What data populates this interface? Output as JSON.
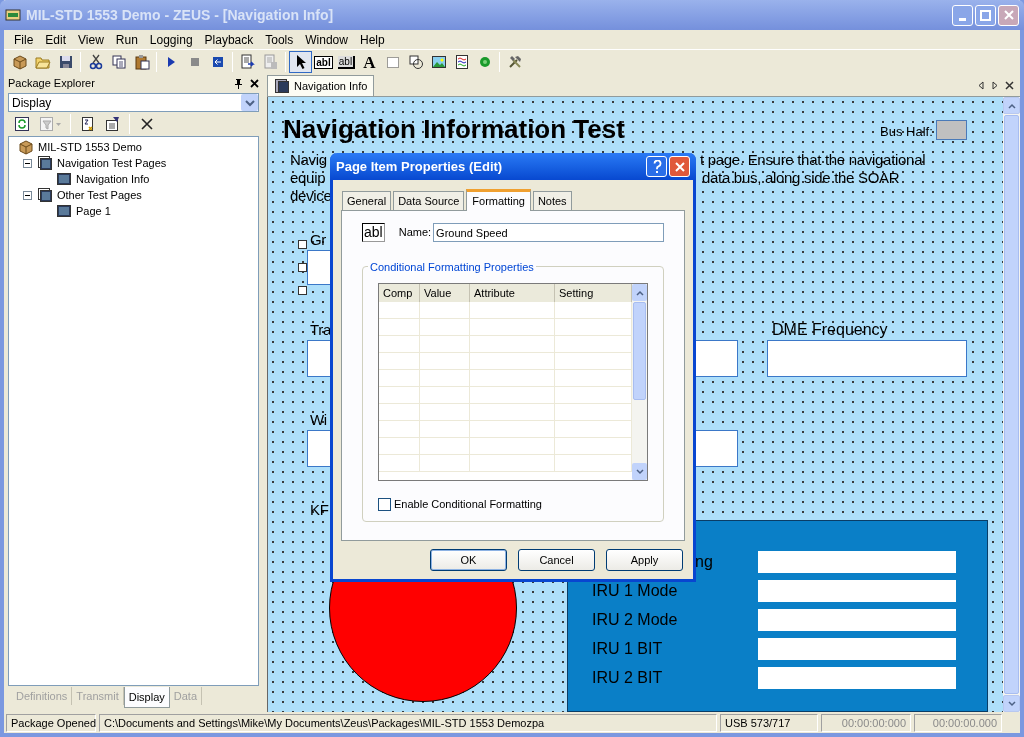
{
  "window": {
    "title": "MIL-STD 1553 Demo - ZEUS - [Navigation Info]"
  },
  "menu": [
    "File",
    "Edit",
    "View",
    "Run",
    "Logging",
    "Playback",
    "Tools",
    "Window",
    "Help"
  ],
  "toolbar": {
    "pointer_selected": true,
    "text_tools": [
      "abl",
      "abl",
      "A"
    ]
  },
  "package_explorer": {
    "title": "Package Explorer",
    "filter": "Display",
    "tree": [
      {
        "label": "MIL-STD 1553 Demo",
        "children": [
          {
            "label": "Navigation Test Pages",
            "expanded": true,
            "children": [
              {
                "label": "Navigation Info"
              }
            ]
          },
          {
            "label": "Other Test Pages",
            "expanded": true,
            "children": [
              {
                "label": "Page 1"
              }
            ]
          }
        ]
      }
    ],
    "tabs": [
      {
        "label": "Definitions",
        "selected": false
      },
      {
        "label": "Transmit",
        "selected": false
      },
      {
        "label": "Display",
        "selected": true
      },
      {
        "label": "Data",
        "selected": false
      }
    ]
  },
  "document_tab": {
    "label": "Navigation Info"
  },
  "canvas": {
    "title": "Navigation Information Test",
    "bus_half_label": "Bus Half:",
    "description_fragments": [
      "Navig",
      "t page. Ensure that the navigational",
      "equip",
      "data bus, along side the SOAR",
      "device"
    ],
    "labels": [
      "Gr",
      "Tra",
      "DME Frequency",
      "Wi",
      "KF"
    ],
    "panel_labels": [
      "ng",
      "IRU 1 Mode",
      "IRU 2 Mode",
      "IRU 1 BIT",
      "IRU 2 BIT"
    ]
  },
  "dialog": {
    "title": "Page Item Properties (Edit)",
    "tabs": [
      {
        "label": "General",
        "selected": false
      },
      {
        "label": "Data Source",
        "selected": false
      },
      {
        "label": "Formatting",
        "selected": true
      },
      {
        "label": "Notes",
        "selected": false
      }
    ],
    "icon_text": "abl",
    "name_label": "Name:",
    "name_value": "Ground Speed",
    "group_title": "Conditional Formatting Properties",
    "columns": [
      "Comp",
      "Value",
      "Attribute",
      "Setting"
    ],
    "checkbox": {
      "label": "Enable Conditional Formatting",
      "checked": false
    },
    "buttons": [
      "OK",
      "Cancel",
      "Apply"
    ]
  },
  "status_bar": [
    "Package Opened",
    "C:\\Documents and Settings\\Mike\\My Documents\\Zeus\\Packages\\MIL-STD 1553 Demozpa",
    "USB 573/717",
    "00:00:00:000",
    "00:00:00.000"
  ]
}
